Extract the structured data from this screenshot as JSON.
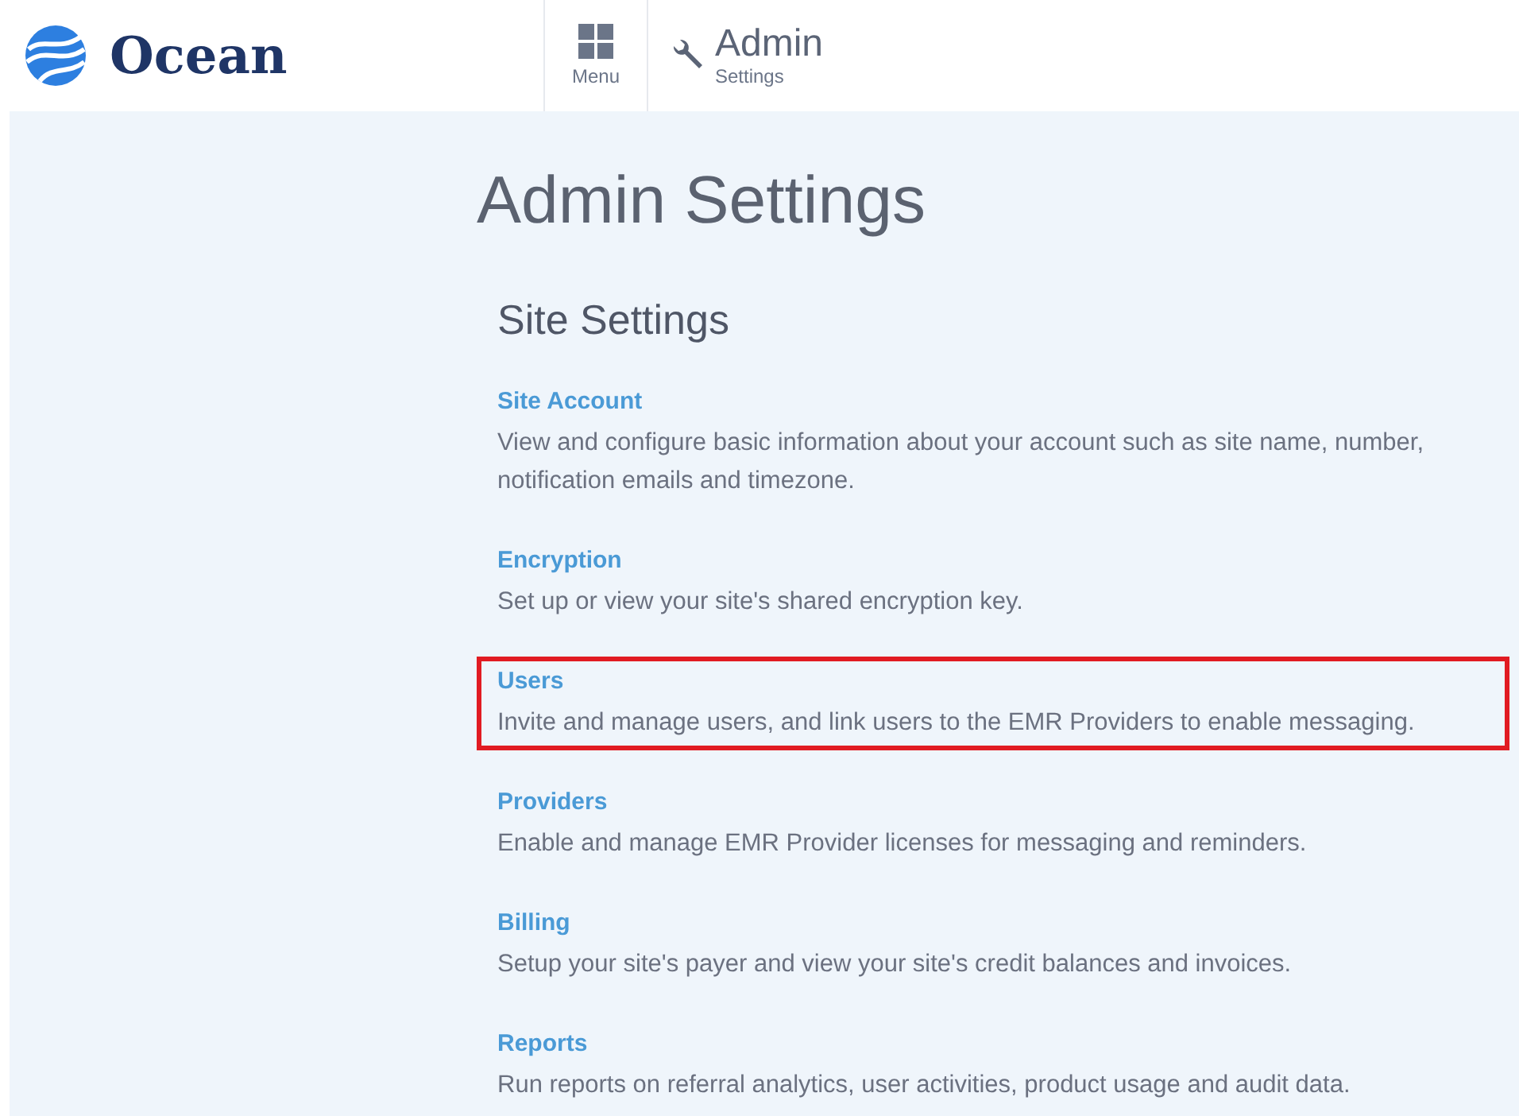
{
  "header": {
    "brand": "Ocean",
    "menu_label": "Menu",
    "section_title": "Admin",
    "section_subtitle": "Settings"
  },
  "page_title": "Admin Settings",
  "section": {
    "title": "Site Settings",
    "items": [
      {
        "title": "Site Account",
        "description": "View and configure basic information about your account such as site name, number, notification emails and timezone.",
        "highlighted": false
      },
      {
        "title": "Encryption",
        "description": "Set up or view your site's shared encryption key.",
        "highlighted": false
      },
      {
        "title": "Users",
        "description": "Invite and manage users, and link users to the EMR Providers to enable messaging.",
        "highlighted": true
      },
      {
        "title": "Providers",
        "description": "Enable and manage EMR Provider licenses for messaging and reminders.",
        "highlighted": false
      },
      {
        "title": "Billing",
        "description": "Setup your site's payer and view your site's credit balances and invoices.",
        "highlighted": false
      },
      {
        "title": "Reports",
        "description": "Run reports on referral analytics, user activities, product usage and audit data.",
        "highlighted": false
      }
    ]
  }
}
